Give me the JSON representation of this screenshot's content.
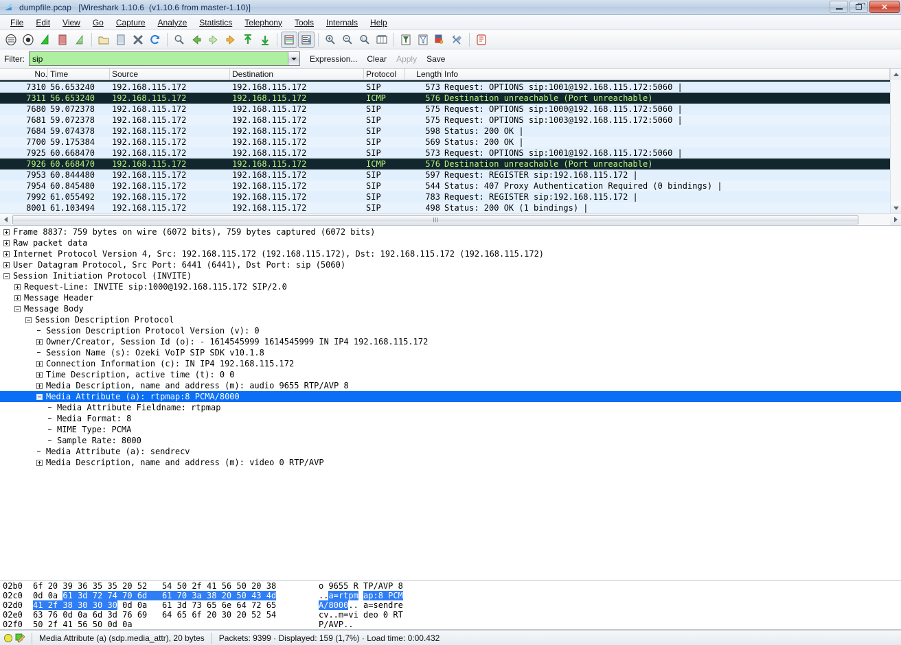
{
  "window": {
    "title": "dumpfile.pcap   [Wireshark 1.10.6  (v1.10.6 from master-1.10)]",
    "app_icon": "wireshark-fin-icon",
    "minimize_label": "Minimize",
    "maximize_label": "Restore",
    "close_label": "Close"
  },
  "menu": [
    {
      "label": "File"
    },
    {
      "label": "Edit"
    },
    {
      "label": "View"
    },
    {
      "label": "Go"
    },
    {
      "label": "Capture"
    },
    {
      "label": "Analyze"
    },
    {
      "label": "Statistics"
    },
    {
      "label": "Telephony"
    },
    {
      "label": "Tools"
    },
    {
      "label": "Internals"
    },
    {
      "label": "Help"
    }
  ],
  "toolbar": [
    {
      "name": "interfaces-icon",
      "group": 0
    },
    {
      "name": "capture-options-icon",
      "group": 0
    },
    {
      "name": "start-capture-icon",
      "group": 0
    },
    {
      "name": "stop-capture-icon",
      "group": 0
    },
    {
      "name": "restart-capture-icon",
      "group": 0
    },
    {
      "name": "open-file-icon",
      "group": 1
    },
    {
      "name": "save-file-icon",
      "group": 1
    },
    {
      "name": "close-file-icon",
      "group": 1
    },
    {
      "name": "reload-icon",
      "group": 1
    },
    {
      "name": "find-packet-icon",
      "group": 2
    },
    {
      "name": "go-back-icon",
      "group": 2
    },
    {
      "name": "go-forward-icon",
      "group": 2
    },
    {
      "name": "go-to-packet-icon",
      "group": 2
    },
    {
      "name": "go-first-packet-icon",
      "group": 2
    },
    {
      "name": "go-last-packet-icon",
      "group": 2
    },
    {
      "name": "colorize-packets-icon",
      "group": 3
    },
    {
      "name": "auto-scroll-icon",
      "group": 3
    },
    {
      "name": "zoom-in-icon",
      "group": 4
    },
    {
      "name": "zoom-out-icon",
      "group": 4
    },
    {
      "name": "zoom-reset-icon",
      "group": 4
    },
    {
      "name": "resize-columns-icon",
      "group": 4
    },
    {
      "name": "capture-filters-icon",
      "group": 5
    },
    {
      "name": "display-filters-icon",
      "group": 5
    },
    {
      "name": "coloring-rules-icon",
      "group": 5
    },
    {
      "name": "preferences-icon",
      "group": 5
    },
    {
      "name": "help-contents-icon",
      "group": 6
    }
  ],
  "filter": {
    "label": "Filter:",
    "value": "sip",
    "placeholder": "",
    "background_color": "#aef0a0",
    "expression_label": "Expression...",
    "clear_label": "Clear",
    "apply_label": "Apply",
    "save_label": "Save"
  },
  "packet_list": {
    "columns": [
      "No.",
      "Time",
      "Source",
      "Destination",
      "Protocol",
      "Length",
      "Info"
    ],
    "rows": [
      {
        "no": "7310",
        "time": "56.653240",
        "src": "192.168.115.172",
        "dst": "192.168.115.172",
        "proto": "SIP",
        "len": "573",
        "info": "Request: OPTIONS sip:1001@192.168.115.172:5060 |",
        "style": "sip"
      },
      {
        "no": "7311",
        "time": "56.653240",
        "src": "192.168.115.172",
        "dst": "192.168.115.172",
        "proto": "ICMP",
        "len": "576",
        "info": "Destination unreachable (Port unreachable)",
        "style": "icmp"
      },
      {
        "no": "7680",
        "time": "59.072378",
        "src": "192.168.115.172",
        "dst": "192.168.115.172",
        "proto": "SIP",
        "len": "575",
        "info": "Request: OPTIONS sip:1000@192.168.115.172:5060 |",
        "style": "sip"
      },
      {
        "no": "7681",
        "time": "59.072378",
        "src": "192.168.115.172",
        "dst": "192.168.115.172",
        "proto": "SIP",
        "len": "575",
        "info": "Request: OPTIONS sip:1003@192.168.115.172:5060 |",
        "style": "sip"
      },
      {
        "no": "7684",
        "time": "59.074378",
        "src": "192.168.115.172",
        "dst": "192.168.115.172",
        "proto": "SIP",
        "len": "598",
        "info": "Status: 200 OK |",
        "style": "sip"
      },
      {
        "no": "7700",
        "time": "59.175384",
        "src": "192.168.115.172",
        "dst": "192.168.115.172",
        "proto": "SIP",
        "len": "569",
        "info": "Status: 200 OK |",
        "style": "sip"
      },
      {
        "no": "7925",
        "time": "60.668470",
        "src": "192.168.115.172",
        "dst": "192.168.115.172",
        "proto": "SIP",
        "len": "573",
        "info": "Request: OPTIONS sip:1001@192.168.115.172:5060 |",
        "style": "sip"
      },
      {
        "no": "7926",
        "time": "60.668470",
        "src": "192.168.115.172",
        "dst": "192.168.115.172",
        "proto": "ICMP",
        "len": "576",
        "info": "Destination unreachable (Port unreachable)",
        "style": "icmp"
      },
      {
        "no": "7953",
        "time": "60.844480",
        "src": "192.168.115.172",
        "dst": "192.168.115.172",
        "proto": "SIP",
        "len": "597",
        "info": "Request: REGISTER sip:192.168.115.172 |",
        "style": "sip"
      },
      {
        "no": "7954",
        "time": "60.845480",
        "src": "192.168.115.172",
        "dst": "192.168.115.172",
        "proto": "SIP",
        "len": "544",
        "info": "Status: 407 Proxy Authentication Required    (0 bindings) |",
        "style": "sip"
      },
      {
        "no": "7992",
        "time": "61.055492",
        "src": "192.168.115.172",
        "dst": "192.168.115.172",
        "proto": "SIP",
        "len": "783",
        "info": "Request: REGISTER sip:192.168.115.172 |",
        "style": "sip"
      },
      {
        "no": "8001",
        "time": "61.103494",
        "src": "192.168.115.172",
        "dst": "192.168.115.172",
        "proto": "SIP",
        "len": "498",
        "info": "Status: 200 OK    (1 bindings) |",
        "style": "sip"
      }
    ]
  },
  "detail_tree": [
    {
      "indent": 0,
      "twist": "plus",
      "text": "Frame 8837: 759 bytes on wire (6072 bits), 759 bytes captured (6072 bits)"
    },
    {
      "indent": 0,
      "twist": "plus",
      "text": "Raw packet data"
    },
    {
      "indent": 0,
      "twist": "plus",
      "text": "Internet Protocol Version 4, Src: 192.168.115.172 (192.168.115.172), Dst: 192.168.115.172 (192.168.115.172)"
    },
    {
      "indent": 0,
      "twist": "plus",
      "text": "User Datagram Protocol, Src Port: 6441 (6441), Dst Port: sip (5060)"
    },
    {
      "indent": 0,
      "twist": "minus",
      "text": "Session Initiation Protocol (INVITE)"
    },
    {
      "indent": 1,
      "twist": "plus",
      "text": "Request-Line: INVITE sip:1000@192.168.115.172 SIP/2.0"
    },
    {
      "indent": 1,
      "twist": "plus",
      "text": "Message Header"
    },
    {
      "indent": 1,
      "twist": "minus",
      "text": "Message Body"
    },
    {
      "indent": 2,
      "twist": "minus",
      "text": "Session Description Protocol"
    },
    {
      "indent": 3,
      "twist": "none",
      "text": "Session Description Protocol Version (v): 0"
    },
    {
      "indent": 3,
      "twist": "plus",
      "text": "Owner/Creator, Session Id (o): - 1614545999 1614545999 IN IP4 192.168.115.172"
    },
    {
      "indent": 3,
      "twist": "none",
      "text": "Session Name (s): Ozeki VoIP SIP SDK v10.1.8"
    },
    {
      "indent": 3,
      "twist": "plus",
      "text": "Connection Information (c): IN IP4 192.168.115.172"
    },
    {
      "indent": 3,
      "twist": "plus",
      "text": "Time Description, active time (t): 0 0"
    },
    {
      "indent": 3,
      "twist": "plus",
      "text": "Media Description, name and address (m): audio 9655 RTP/AVP 8"
    },
    {
      "indent": 3,
      "twist": "minus",
      "text": "Media Attribute (a): rtpmap:8 PCMA/8000",
      "selected": true
    },
    {
      "indent": 4,
      "twist": "none",
      "text": "Media Attribute Fieldname: rtpmap"
    },
    {
      "indent": 4,
      "twist": "none",
      "text": "Media Format: 8"
    },
    {
      "indent": 4,
      "twist": "none",
      "text": "MIME Type: PCMA"
    },
    {
      "indent": 4,
      "twist": "none",
      "text": "Sample Rate: 8000"
    },
    {
      "indent": 3,
      "twist": "none",
      "text": "Media Attribute (a): sendrecv"
    },
    {
      "indent": 3,
      "twist": "plus",
      "text": "Media Description, name and address (m): video 0 RTP/AVP"
    }
  ],
  "hex_dump": [
    {
      "offset": "02b0",
      "bytes": [
        {
          "v": "6f",
          "hl": false
        },
        {
          "v": "20",
          "hl": false
        },
        {
          "v": "39",
          "hl": false
        },
        {
          "v": "36",
          "hl": false
        },
        {
          "v": "35",
          "hl": false
        },
        {
          "v": "35",
          "hl": false
        },
        {
          "v": "20",
          "hl": false
        },
        {
          "v": "52",
          "hl": false
        },
        {
          "v": "54",
          "hl": false
        },
        {
          "v": "50",
          "hl": false
        },
        {
          "v": "2f",
          "hl": false
        },
        {
          "v": "41",
          "hl": false
        },
        {
          "v": "56",
          "hl": false
        },
        {
          "v": "50",
          "hl": false
        },
        {
          "v": "20",
          "hl": false
        },
        {
          "v": "38",
          "hl": false
        }
      ],
      "ascii": [
        {
          "v": "o 9655 R",
          "hl": false
        },
        {
          "v": " ",
          "hl": false
        },
        {
          "v": "TP/AVP 8",
          "hl": false
        }
      ]
    },
    {
      "offset": "02c0",
      "bytes": [
        {
          "v": "0d",
          "hl": false
        },
        {
          "v": "0a",
          "hl": false
        },
        {
          "v": "61",
          "hl": true
        },
        {
          "v": "3d",
          "hl": true
        },
        {
          "v": "72",
          "hl": true
        },
        {
          "v": "74",
          "hl": true
        },
        {
          "v": "70",
          "hl": true
        },
        {
          "v": "6d",
          "hl": true
        },
        {
          "v": "61",
          "hl": true
        },
        {
          "v": "70",
          "hl": true
        },
        {
          "v": "3a",
          "hl": true
        },
        {
          "v": "38",
          "hl": true
        },
        {
          "v": "20",
          "hl": true
        },
        {
          "v": "50",
          "hl": true
        },
        {
          "v": "43",
          "hl": true
        },
        {
          "v": "4d",
          "hl": true
        }
      ],
      "ascii": [
        {
          "v": "..",
          "hl": false
        },
        {
          "v": "a=rtpm",
          "hl": true
        },
        {
          "v": " ",
          "hl": false
        },
        {
          "v": "ap:8 PCM",
          "hl": true
        }
      ]
    },
    {
      "offset": "02d0",
      "bytes": [
        {
          "v": "41",
          "hl": true
        },
        {
          "v": "2f",
          "hl": true
        },
        {
          "v": "38",
          "hl": true
        },
        {
          "v": "30",
          "hl": true
        },
        {
          "v": "30",
          "hl": true
        },
        {
          "v": "30",
          "hl": true
        },
        {
          "v": "0d",
          "hl": false
        },
        {
          "v": "0a",
          "hl": false
        },
        {
          "v": "61",
          "hl": false
        },
        {
          "v": "3d",
          "hl": false
        },
        {
          "v": "73",
          "hl": false
        },
        {
          "v": "65",
          "hl": false
        },
        {
          "v": "6e",
          "hl": false
        },
        {
          "v": "64",
          "hl": false
        },
        {
          "v": "72",
          "hl": false
        },
        {
          "v": "65",
          "hl": false
        }
      ],
      "ascii": [
        {
          "v": "A/8000",
          "hl": true
        },
        {
          "v": "..",
          "hl": false
        },
        {
          "v": " ",
          "hl": false
        },
        {
          "v": "a=sendre",
          "hl": false
        }
      ]
    },
    {
      "offset": "02e0",
      "bytes": [
        {
          "v": "63",
          "hl": false
        },
        {
          "v": "76",
          "hl": false
        },
        {
          "v": "0d",
          "hl": false
        },
        {
          "v": "0a",
          "hl": false
        },
        {
          "v": "6d",
          "hl": false
        },
        {
          "v": "3d",
          "hl": false
        },
        {
          "v": "76",
          "hl": false
        },
        {
          "v": "69",
          "hl": false
        },
        {
          "v": "64",
          "hl": false
        },
        {
          "v": "65",
          "hl": false
        },
        {
          "v": "6f",
          "hl": false
        },
        {
          "v": "20",
          "hl": false
        },
        {
          "v": "30",
          "hl": false
        },
        {
          "v": "20",
          "hl": false
        },
        {
          "v": "52",
          "hl": false
        },
        {
          "v": "54",
          "hl": false
        }
      ],
      "ascii": [
        {
          "v": "cv..m=vi",
          "hl": false
        },
        {
          "v": " ",
          "hl": false
        },
        {
          "v": "deo 0 RT",
          "hl": false
        }
      ]
    },
    {
      "offset": "02f0",
      "bytes": [
        {
          "v": "50",
          "hl": false
        },
        {
          "v": "2f",
          "hl": false
        },
        {
          "v": "41",
          "hl": false
        },
        {
          "v": "56",
          "hl": false
        },
        {
          "v": "50",
          "hl": false
        },
        {
          "v": "0d",
          "hl": false
        },
        {
          "v": "0a",
          "hl": false
        }
      ],
      "ascii": [
        {
          "v": "P/AVP..",
          "hl": false
        }
      ]
    }
  ],
  "statusbar": {
    "expert_icon": "expert-info-circle-icon",
    "annotation_icon": "capture-comment-icon",
    "field_text": "Media Attribute (a) (sdp.media_attr), 20 bytes",
    "packets_text": "Packets: 9399 · Displayed: 159 (1,7%)  · Load time: 0:00.432"
  },
  "colors": {
    "sip_row_bg": "#e2f0fd",
    "icmp_row_bg": "#12262e",
    "icmp_row_fg": "#b7f57a",
    "selection_bg": "#0b6ff5",
    "hex_highlight_bg": "#2f7ef5",
    "filter_valid_bg": "#aef0a0"
  }
}
